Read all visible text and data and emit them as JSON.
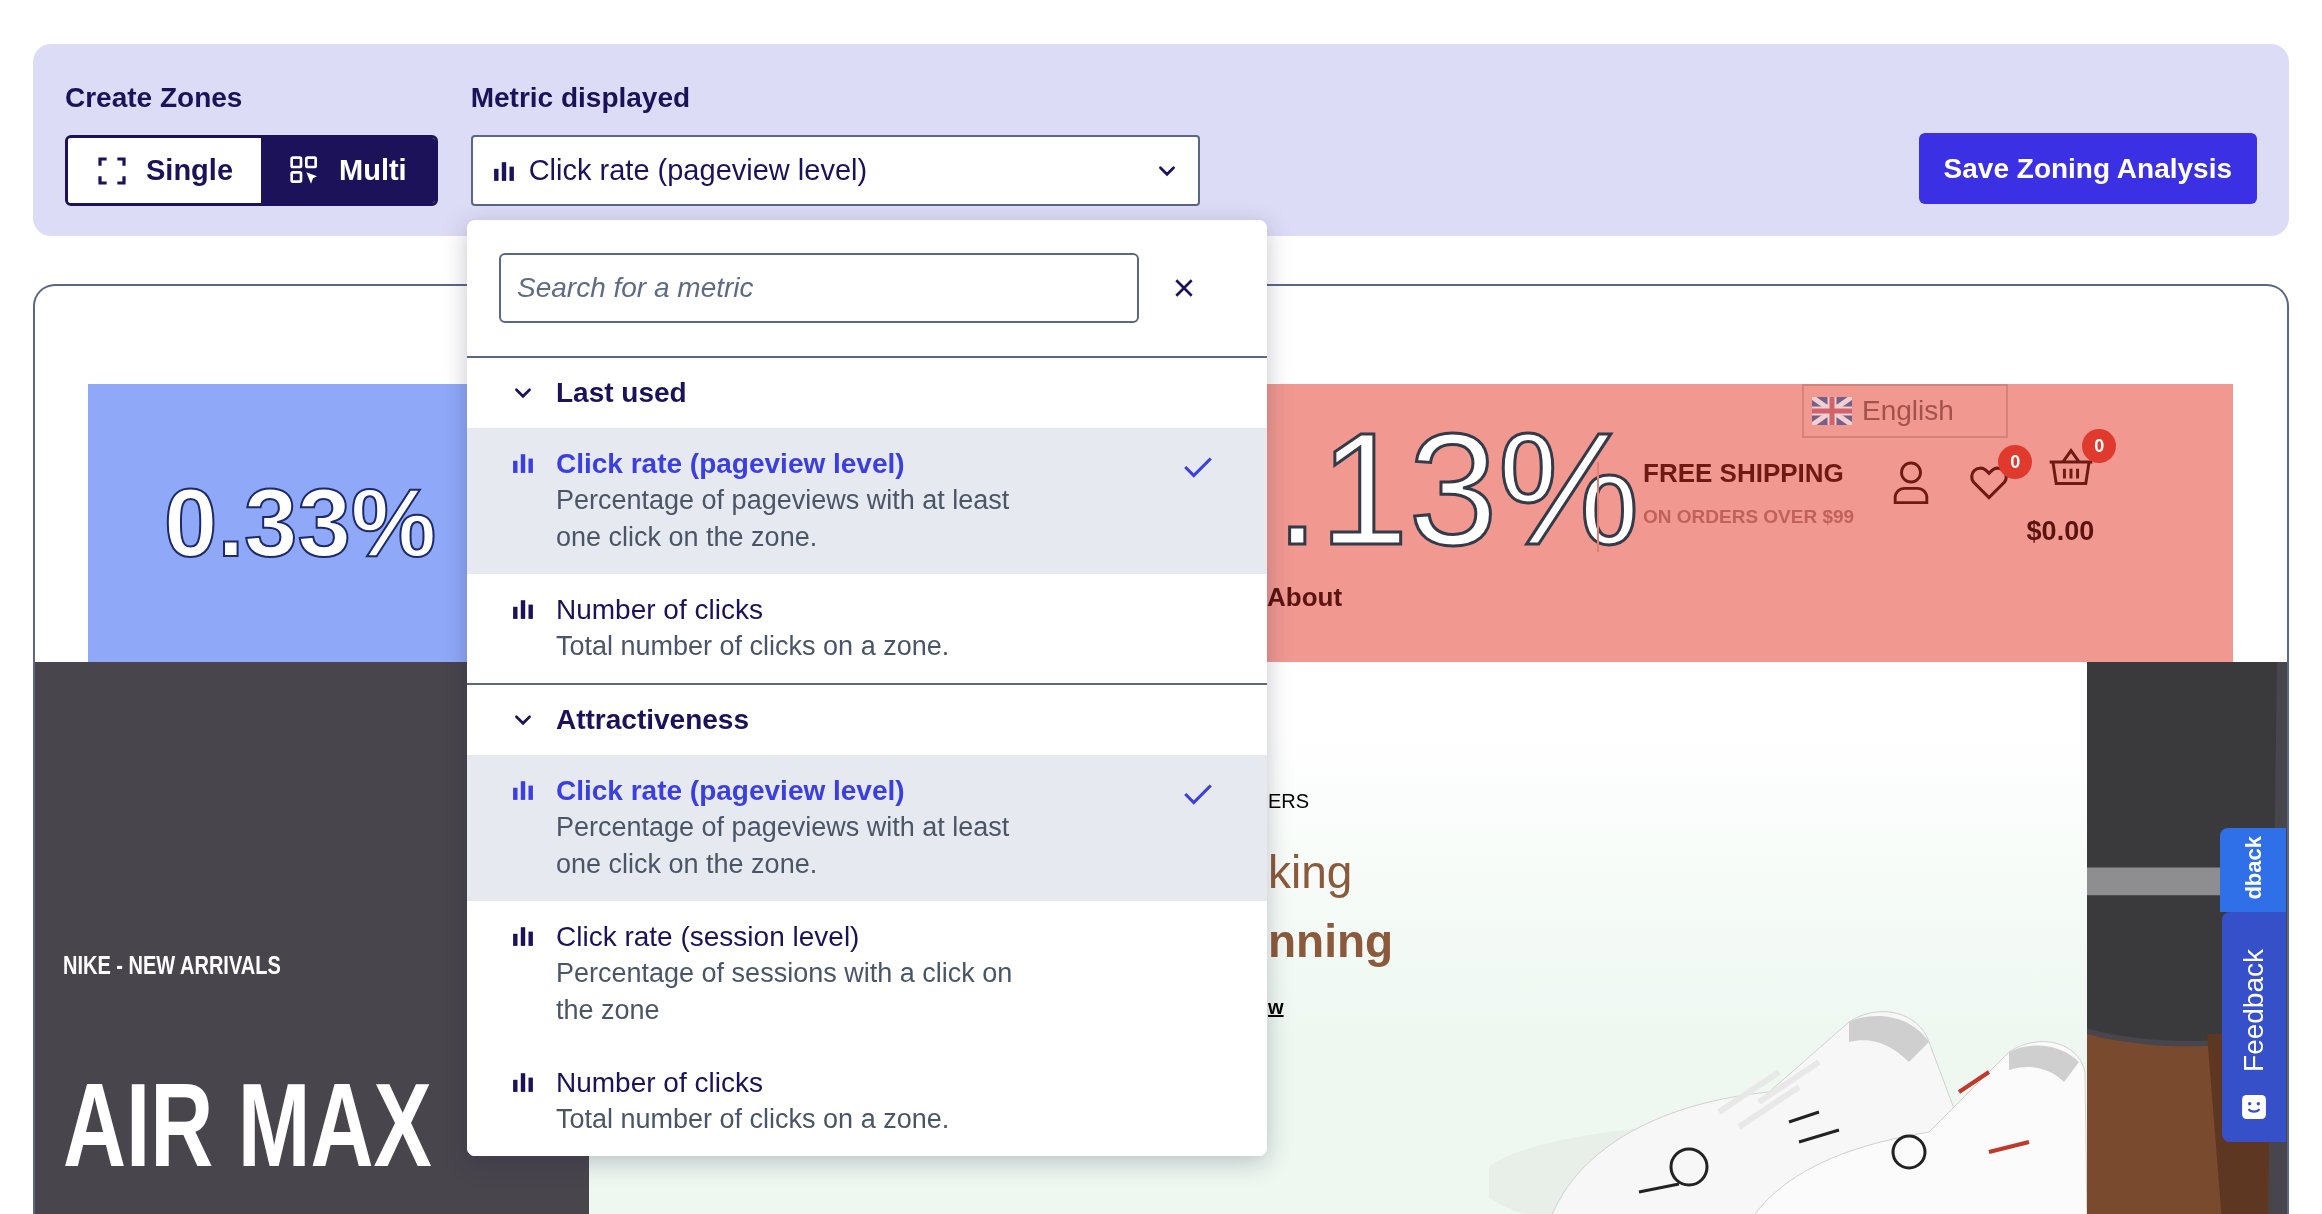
{
  "toolbar": {
    "create_zones": {
      "label": "Create Zones",
      "modes": [
        {
          "label": "Single",
          "kind": "single",
          "selected": false
        },
        {
          "label": "Multi",
          "kind": "multi",
          "selected": true
        }
      ]
    },
    "metric": {
      "label": "Metric displayed",
      "value": "Click rate (pageview level)",
      "expanded": true
    },
    "save_button": "Save Zoning Analysis"
  },
  "metric_menu": {
    "search": {
      "placeholder": "Search for a metric"
    },
    "groups": [
      {
        "title": "Last used",
        "expanded": true,
        "items": [
          {
            "title": "Click rate (pageview level)",
            "description": "Percentage of pageviews with at least one click on the zone.",
            "selected": true
          },
          {
            "title": "Number of clicks",
            "description": "Total number of clicks on a zone.",
            "selected": false
          }
        ]
      },
      {
        "title": "Attractiveness",
        "expanded": true,
        "items": [
          {
            "title": "Click rate (pageview level)",
            "description": "Percentage of pageviews with at least one click on the zone.",
            "selected": true
          },
          {
            "title": "Click rate (session level)",
            "description": "Percentage of sessions with a click on the zone",
            "selected": false
          },
          {
            "title": "Number of clicks",
            "description": "Total number of clicks on a zone.",
            "selected": false
          }
        ]
      }
    ]
  },
  "preview": {
    "zones": [
      {
        "value": "0.33%",
        "color": "#8fa8f8"
      },
      {
        "value": ".13%",
        "color": "#f19891"
      }
    ],
    "header": {
      "about": "About",
      "language": "English",
      "shipping_title": "FREE SHIPPING",
      "shipping_note": "ON ORDERS OVER $99",
      "wishlist_count": "0",
      "cart_count": "0",
      "cart_total": "$0.00"
    },
    "banner": {
      "eyebrow": "NIKE - NEW ARRIVALS",
      "headline": "AIR MAX"
    },
    "hero": {
      "eyebrow": "ERS",
      "line_1": "king",
      "line_2": "nning",
      "link": "w"
    },
    "feedback_tabs": [
      "dback",
      "Feedback"
    ]
  }
}
